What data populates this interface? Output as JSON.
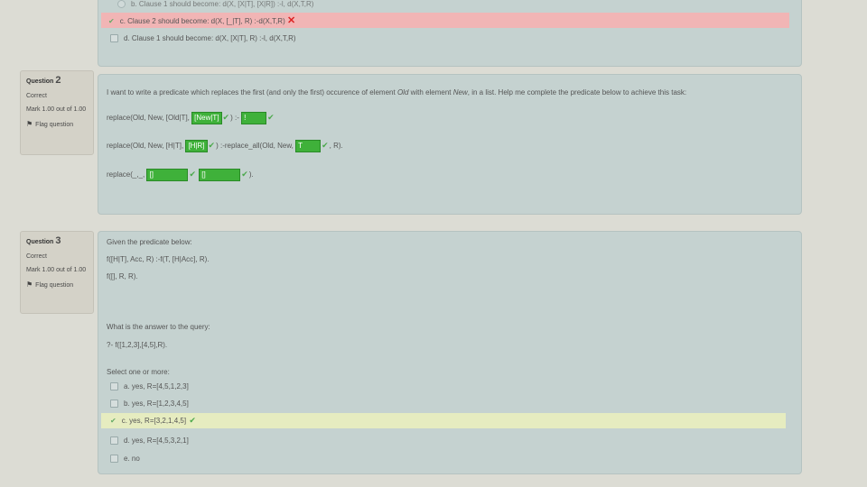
{
  "q1": {
    "option_b": "b. Clause 1 should become: d(X, [X|T], [X|R]) :-l, d(X,T,R)",
    "option_c_label": "c. Clause 2 should become: d(X, [_|T], R) :-d(X,T,R)",
    "option_d_label": "d. Clause 1 should become: d(X, [X|T], R) :-l, d(X,T,R)"
  },
  "q2": {
    "label": "Question",
    "number": "2",
    "status": "Correct",
    "mark": "Mark 1.00 out of 1.00",
    "flag": "Flag question",
    "prompt_part1": "I want to write a predicate which replaces the first (and only the first) occurence of element ",
    "prompt_old": "Old",
    "prompt_part2": " with element ",
    "prompt_new": "New",
    "prompt_part3": ", in a list. Help me complete the predicate below to achieve this task:",
    "line1_pre": "replace(Old, New, [Old|T],",
    "line1_drop1": "[New|T]",
    "line1_mid": ") :-",
    "line1_drop2": "!",
    "line2_pre": "replace(Old, New, [H|T],",
    "line2_drop1": "[H|R]",
    "line2_mid": ") :-replace_all(Old, New,",
    "line2_drop2": "T",
    "line2_end": ", R).",
    "line3_pre": "replace(_,_,",
    "line3_drop1": "[]",
    "line3_drop2": "[]",
    "line3_end": ")."
  },
  "q3": {
    "label": "Question",
    "number": "3",
    "status": "Correct",
    "mark": "Mark 1.00 out of 1.00",
    "flag": "Flag question",
    "intro": "Given the predicate below:",
    "code1": "f([H|T], Acc, R) :-f(T, [H|Acc], R).",
    "code2": "f([], R, R).",
    "question": "What is the answer to the query:",
    "query": "?- f([1,2,3],[4,5],R).",
    "select": "Select one or more:",
    "options": [
      "a. yes, R=[4,5,1,2,3]",
      "b. yes, R=[1,2,3,4,5]",
      "c. yes, R=[3,2,1,4,5]",
      "d. yes, R=[4,5,3,2,1]",
      "e. no"
    ]
  },
  "colors": {
    "correct_drop": "#3fb13a",
    "tick": "#4aa84a",
    "wrong_bg": "#f1b5b5",
    "correct_bg": "#e6ecc0"
  }
}
